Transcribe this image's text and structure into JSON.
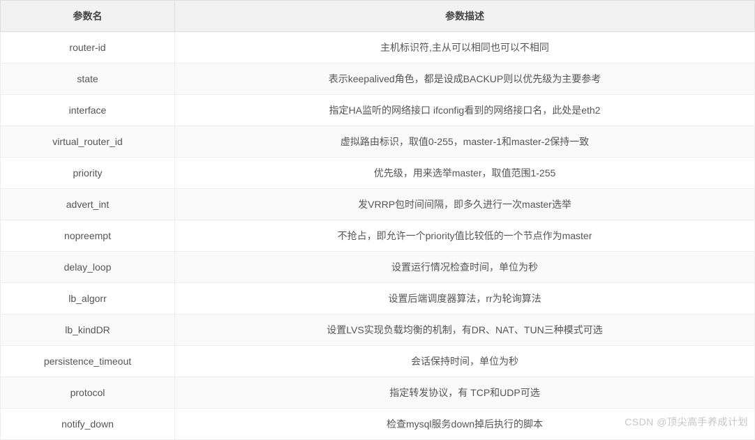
{
  "table": {
    "headers": {
      "param": "参数名",
      "desc": "参数描述"
    },
    "rows": [
      {
        "param": "router-id",
        "desc": "主机标识符,主从可以相同也可以不相同"
      },
      {
        "param": "state",
        "desc": "表示keepalived角色，都是设成BACKUP则以优先级为主要参考"
      },
      {
        "param": "interface",
        "desc": "指定HA监听的网络接口 ifconfig看到的网络接口名，此处是eth2"
      },
      {
        "param": "virtual_router_id",
        "desc": "虚拟路由标识，取值0-255，master-1和master-2保持一致"
      },
      {
        "param": "priority",
        "desc": "优先级，用来选举master，取值范围1-255"
      },
      {
        "param": "advert_int",
        "desc": "发VRRP包时间间隔，即多久进行一次master选举"
      },
      {
        "param": "nopreempt",
        "desc": "不抢占，即允许一个priority值比较低的一个节点作为master"
      },
      {
        "param": "delay_loop",
        "desc": "设置运行情况检查时间，单位为秒"
      },
      {
        "param": "lb_algorr",
        "desc": "设置后端调度器算法，rr为轮询算法"
      },
      {
        "param": "lb_kindDR",
        "desc": "设置LVS实现负载均衡的机制，有DR、NAT、TUN三种模式可选"
      },
      {
        "param": "persistence_timeout",
        "desc": "会话保持时间，单位为秒"
      },
      {
        "param": "protocol",
        "desc": "指定转发协议，有 TCP和UDP可选"
      },
      {
        "param": "notify_down",
        "desc": "检查mysql服务down掉后执行的脚本"
      }
    ]
  },
  "watermark": "CSDN @顶尖高手养成计划"
}
